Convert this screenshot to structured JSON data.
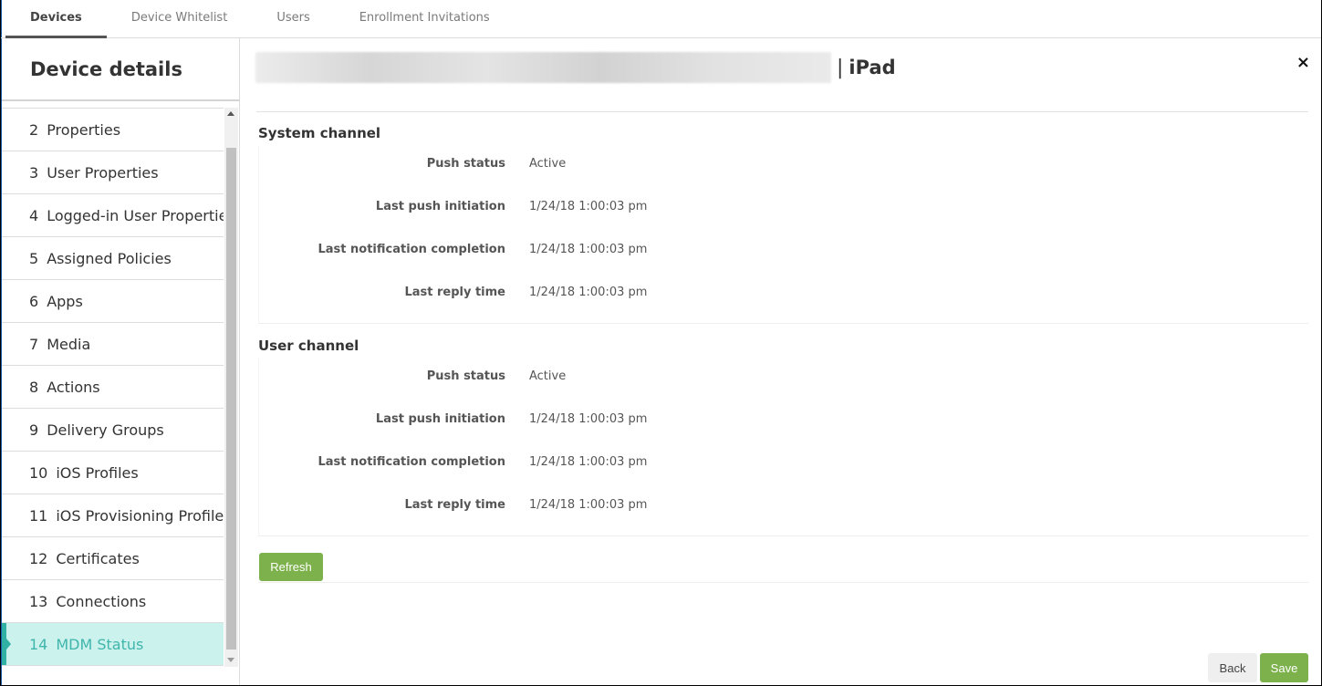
{
  "tabs": [
    {
      "label": "Devices",
      "active": true
    },
    {
      "label": "Device Whitelist",
      "active": false
    },
    {
      "label": "Users",
      "active": false
    },
    {
      "label": "Enrollment Invitations",
      "active": false
    }
  ],
  "sidebar": {
    "title": "Device details",
    "steps": [
      {
        "num": "2",
        "label": "Properties"
      },
      {
        "num": "3",
        "label": "User Properties"
      },
      {
        "num": "4",
        "label": "Logged-in User Properties"
      },
      {
        "num": "5",
        "label": "Assigned Policies"
      },
      {
        "num": "6",
        "label": "Apps"
      },
      {
        "num": "7",
        "label": "Media"
      },
      {
        "num": "8",
        "label": "Actions"
      },
      {
        "num": "9",
        "label": "Delivery Groups"
      },
      {
        "num": "10",
        "label": "iOS Profiles"
      },
      {
        "num": "11",
        "label": "iOS Provisioning Profiles"
      },
      {
        "num": "12",
        "label": "Certificates"
      },
      {
        "num": "13",
        "label": "Connections"
      },
      {
        "num": "14",
        "label": "MDM Status",
        "active": true
      }
    ]
  },
  "header": {
    "separator": "|",
    "device": "iPad",
    "close_icon": "×"
  },
  "system_channel": {
    "title": "System channel",
    "rows": [
      {
        "label": "Push status",
        "value": "Active"
      },
      {
        "label": "Last push initiation",
        "value": "1/24/18 1:00:03 pm"
      },
      {
        "label": "Last notification completion",
        "value": "1/24/18 1:00:03 pm"
      },
      {
        "label": "Last reply time",
        "value": "1/24/18 1:00:03 pm"
      }
    ]
  },
  "user_channel": {
    "title": "User channel",
    "rows": [
      {
        "label": "Push status",
        "value": "Active"
      },
      {
        "label": "Last push initiation",
        "value": "1/24/18 1:00:03 pm"
      },
      {
        "label": "Last notification completion",
        "value": "1/24/18 1:00:03 pm"
      },
      {
        "label": "Last reply time",
        "value": "1/24/18 1:00:03 pm"
      }
    ]
  },
  "buttons": {
    "refresh": "Refresh",
    "back": "Back",
    "save": "Save"
  },
  "colors": {
    "accent_green": "#7cb14b",
    "active_step_bg": "#ccf2ee",
    "active_step_text": "#3fb5ab"
  }
}
